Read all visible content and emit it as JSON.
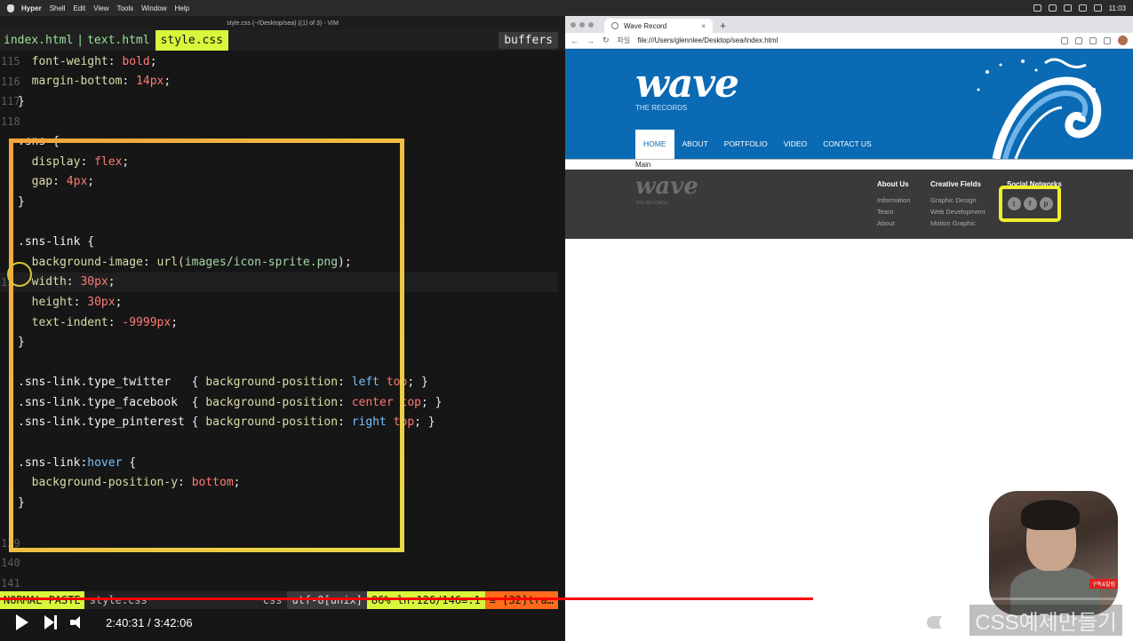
{
  "menubar": {
    "app": "Hyper",
    "items": [
      "Shell",
      "Edit",
      "View",
      "Tools",
      "Window",
      "Help"
    ],
    "clock": "11:03"
  },
  "vim": {
    "window_title": "style.css (~/Desktop/sea) ((1) of 3) - VIM",
    "tabs": [
      "index.html",
      "text.html"
    ],
    "active_tab": "style.css",
    "buffers_label": "buffers",
    "status": {
      "mode": "NORMAL  PASTE",
      "file": "style.css",
      "filetype": "css",
      "encoding": "utf-8[unix]",
      "position": "86% ln:126/146≡:1",
      "warning": "≡ [32]tra…"
    }
  },
  "code_lines": [
    {
      "n": "115",
      "parts": [
        [
          "  ",
          ""
        ],
        [
          "font-weight",
          "prop"
        ],
        [
          ": ",
          ""
        ],
        [
          "bold",
          "val"
        ],
        [
          ";",
          ""
        ]
      ]
    },
    {
      "n": "116",
      "parts": [
        [
          "  ",
          ""
        ],
        [
          "margin-bottom",
          "prop"
        ],
        [
          ": ",
          ""
        ],
        [
          "14px",
          "num2"
        ],
        [
          ";",
          ""
        ]
      ]
    },
    {
      "n": "117",
      "parts": [
        [
          "}",
          "sel"
        ]
      ]
    },
    {
      "n": "118",
      "parts": []
    },
    {
      "n": "",
      "parts": [
        [
          ".sns {",
          "sel"
        ]
      ]
    },
    {
      "n": "",
      "parts": [
        [
          "  ",
          ""
        ],
        [
          "display",
          "prop"
        ],
        [
          ": ",
          ""
        ],
        [
          "flex",
          "val"
        ],
        [
          ";",
          ""
        ]
      ]
    },
    {
      "n": "",
      "parts": [
        [
          "  ",
          ""
        ],
        [
          "gap",
          "prop"
        ],
        [
          ": ",
          ""
        ],
        [
          "4px",
          "num2"
        ],
        [
          ";",
          ""
        ]
      ]
    },
    {
      "n": "",
      "parts": [
        [
          "}",
          "sel"
        ]
      ]
    },
    {
      "n": "",
      "parts": []
    },
    {
      "n": "",
      "parts": [
        [
          ".sns-link {",
          "sel"
        ]
      ]
    },
    {
      "n": "",
      "parts": [
        [
          "  ",
          ""
        ],
        [
          "background-image",
          "prop"
        ],
        [
          ": ",
          ""
        ],
        [
          "url(",
          "prop"
        ],
        [
          "images/icon-sprite.png",
          "str"
        ],
        [
          ");",
          ""
        ]
      ]
    },
    {
      "n": "12",
      "parts": [
        [
          "  ",
          ""
        ],
        [
          "width",
          "prop"
        ],
        [
          ": ",
          ""
        ],
        [
          "30px",
          "num2"
        ],
        [
          ";",
          ""
        ]
      ],
      "cur": true
    },
    {
      "n": "",
      "parts": [
        [
          "  ",
          ""
        ],
        [
          "height",
          "prop"
        ],
        [
          ": ",
          ""
        ],
        [
          "30px",
          "num2"
        ],
        [
          ";",
          ""
        ]
      ]
    },
    {
      "n": "",
      "parts": [
        [
          "  ",
          ""
        ],
        [
          "text-indent",
          "prop"
        ],
        [
          ": ",
          ""
        ],
        [
          "-9999px",
          "num2"
        ],
        [
          ";",
          ""
        ]
      ]
    },
    {
      "n": "",
      "parts": [
        [
          "}",
          "sel"
        ]
      ]
    },
    {
      "n": "",
      "parts": []
    },
    {
      "n": "",
      "parts": [
        [
          ".sns-link.type_twitter   ",
          "sel"
        ],
        [
          "{ ",
          ""
        ],
        [
          "background-position",
          "prop"
        ],
        [
          ": ",
          ""
        ],
        [
          "left",
          "kw"
        ],
        [
          " ",
          ""
        ],
        [
          "top",
          "val"
        ],
        [
          "; }",
          ""
        ]
      ]
    },
    {
      "n": "",
      "parts": [
        [
          ".sns-link.type_facebook  ",
          "sel"
        ],
        [
          "{ ",
          ""
        ],
        [
          "background-position",
          "prop"
        ],
        [
          ": ",
          ""
        ],
        [
          "center",
          "val"
        ],
        [
          " ",
          ""
        ],
        [
          "top",
          "val"
        ],
        [
          "; }",
          ""
        ]
      ]
    },
    {
      "n": "",
      "parts": [
        [
          ".sns-link.type_pinterest ",
          "sel"
        ],
        [
          "{ ",
          ""
        ],
        [
          "background-position",
          "prop"
        ],
        [
          ": ",
          ""
        ],
        [
          "right",
          "kw"
        ],
        [
          " ",
          ""
        ],
        [
          "top",
          "val"
        ],
        [
          "; }",
          ""
        ]
      ]
    },
    {
      "n": "",
      "parts": []
    },
    {
      "n": "",
      "parts": [
        [
          ".sns-link:",
          "sel"
        ],
        [
          "hover",
          "kw"
        ],
        [
          " {",
          "sel"
        ]
      ]
    },
    {
      "n": "",
      "parts": [
        [
          "  ",
          ""
        ],
        [
          "background-position-y",
          "prop"
        ],
        [
          ": ",
          ""
        ],
        [
          "bottom",
          "val"
        ],
        [
          ";",
          ""
        ]
      ]
    },
    {
      "n": "",
      "parts": [
        [
          "}",
          "sel"
        ]
      ]
    },
    {
      "n": "",
      "parts": []
    },
    {
      "n": "139",
      "parts": []
    },
    {
      "n": "140",
      "parts": []
    },
    {
      "n": "141",
      "parts": []
    }
  ],
  "browser": {
    "tab_title": "Wave Record",
    "address_label": "파일",
    "url": "file:///Users/glennlee/Desktop/sea/index.html"
  },
  "site": {
    "logo": "wave",
    "logo_sub": "THE RECORDS",
    "nav": [
      "HOME",
      "ABOUT",
      "PORTFOLIO",
      "VIDEO",
      "CONTACT US"
    ],
    "main_label": "Main",
    "footer_logo": "wave",
    "footer_logo_sub": "THE RECORDS",
    "about": {
      "title": "About Us",
      "links": [
        "Information",
        "Team",
        "About"
      ]
    },
    "creative": {
      "title": "Creative Fields",
      "links": [
        "Graphic Design",
        "Web Development",
        "Motion Graphic"
      ]
    },
    "social": {
      "title": "Social Networks",
      "icons": [
        "t",
        "f",
        "p"
      ]
    }
  },
  "player": {
    "time": "2:40:31 / 3:42:06",
    "played_fraction": 0.718,
    "buffered_fraction": 0.727,
    "caption_ghost": "CSS예제만들기",
    "subscribe_badge": "구독&알림"
  },
  "colors": {
    "accent_tab": "#d9f53c",
    "site_blue": "#0a6ab4",
    "highlight_yellow": "#f0ee2c",
    "progress_red": "#ff0000"
  }
}
